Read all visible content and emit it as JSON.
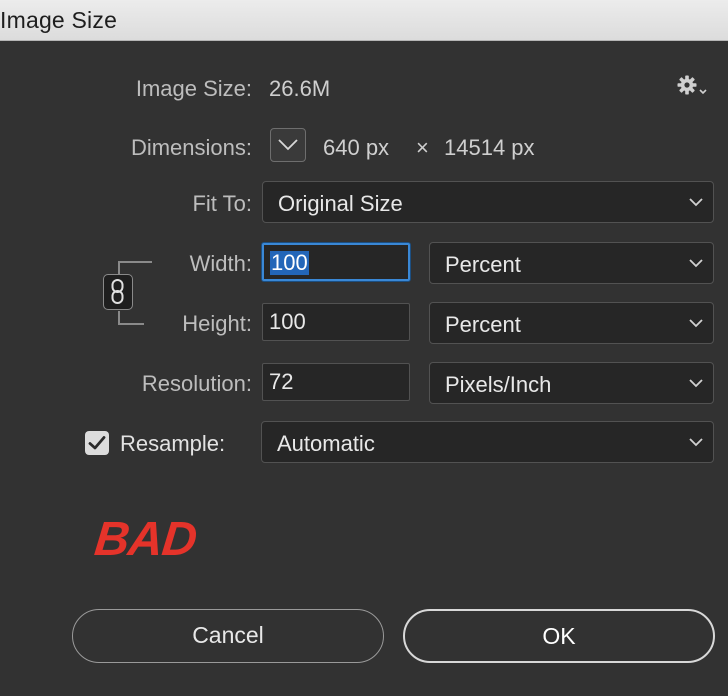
{
  "window": {
    "title": "Image Size"
  },
  "image_size": {
    "label": "Image Size:",
    "value": "26.6M"
  },
  "dimensions": {
    "label": "Dimensions:",
    "width": "640 px",
    "times": "×",
    "height": "14514 px"
  },
  "fit_to": {
    "label": "Fit To:",
    "selected": "Original Size"
  },
  "width": {
    "label": "Width:",
    "value": "100",
    "unit": "Percent"
  },
  "height": {
    "label": "Height:",
    "value": "100",
    "unit": "Percent"
  },
  "resolution": {
    "label": "Resolution:",
    "value": "72",
    "unit": "Pixels/Inch"
  },
  "resample": {
    "label": "Resample:",
    "checked": true,
    "selected": "Automatic"
  },
  "watermark": {
    "text": "BAD",
    "color": "#e5332a"
  },
  "buttons": {
    "cancel": "Cancel",
    "ok": "OK"
  },
  "icons": {
    "settings": "gear-icon",
    "dimensions_toggle": "chevron-down-icon",
    "constrain": "chain-link-icon",
    "checkbox": "checkmark-icon"
  },
  "colors": {
    "background": "#323232",
    "focus": "#3a88d6",
    "selection": "#2366b8"
  }
}
